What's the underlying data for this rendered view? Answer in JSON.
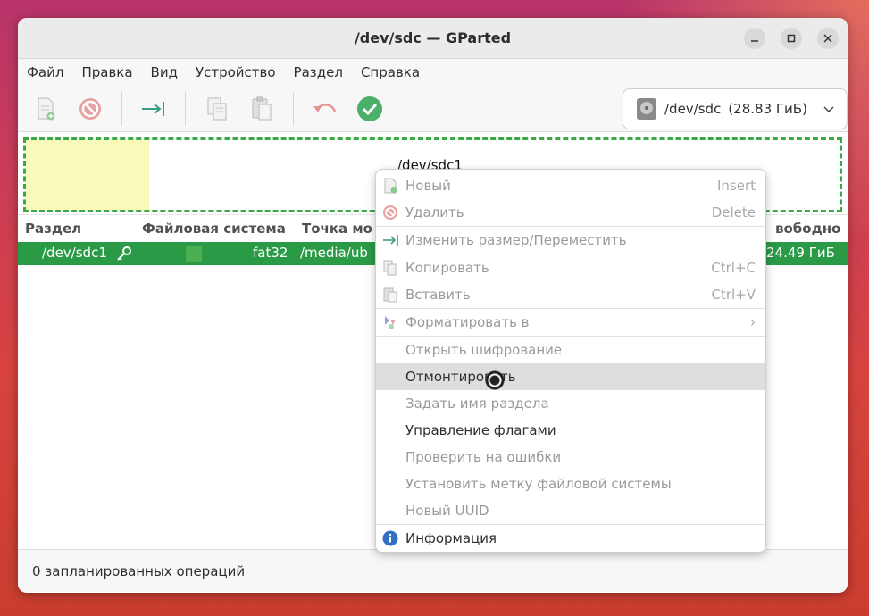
{
  "window": {
    "title": "/dev/sdc — GParted",
    "controls": {
      "minimize": "—",
      "maximize": "□",
      "close": "✕"
    }
  },
  "menubar": [
    "Файл",
    "Правка",
    "Вид",
    "Устройство",
    "Раздел",
    "Справка"
  ],
  "toolbar": {
    "buttons": [
      {
        "icon": "new-partition-icon",
        "enabled": false
      },
      {
        "icon": "delete-icon",
        "enabled": false
      },
      {
        "icon": "resize-move-icon",
        "enabled": true
      },
      {
        "icon": "copy-icon",
        "enabled": false
      },
      {
        "icon": "paste-icon",
        "enabled": false
      },
      {
        "icon": "undo-icon",
        "enabled": false
      },
      {
        "icon": "apply-icon",
        "enabled": true
      }
    ],
    "device": {
      "name": "/dev/sdc",
      "size": "(28.83 ГиБ)"
    }
  },
  "graph": {
    "label": "/dev/sdc1"
  },
  "table": {
    "columns": [
      "Раздел",
      "Файловая система",
      "Точка мо",
      "вободно"
    ],
    "rows": [
      {
        "partition": "/dev/sdc1",
        "fs": "fat32",
        "mount": "/media/ub",
        "free": "24.49 ГиБ",
        "fs_color": "#4caf50"
      }
    ]
  },
  "status": "0 запланированных операций",
  "context_menu": {
    "items": [
      {
        "label": "Новый",
        "accel": "Insert",
        "enabled": false,
        "icon": "new-icon"
      },
      {
        "label": "Удалить",
        "accel": "Delete",
        "enabled": false,
        "icon": "delete-icon"
      },
      {
        "label": "Изменить размер/Переместить",
        "accel": "",
        "enabled": false,
        "icon": "resize-icon"
      },
      {
        "label": "Копировать",
        "accel": "Ctrl+C",
        "enabled": false,
        "icon": "copy-icon"
      },
      {
        "label": "Вставить",
        "accel": "Ctrl+V",
        "enabled": false,
        "icon": "paste-icon"
      },
      {
        "label": "Форматировать в",
        "accel": "›",
        "enabled": false,
        "icon": "format-icon"
      },
      {
        "label": "Открыть шифрование",
        "accel": "",
        "enabled": false,
        "icon": ""
      },
      {
        "label": "Отмонтировать",
        "accel": "",
        "enabled": true,
        "icon": "",
        "highlighted": true
      },
      {
        "label": "Задать имя раздела",
        "accel": "",
        "enabled": false,
        "icon": ""
      },
      {
        "label": "Управление флагами",
        "accel": "",
        "enabled": true,
        "icon": ""
      },
      {
        "label": "Проверить на ошибки",
        "accel": "",
        "enabled": false,
        "icon": ""
      },
      {
        "label": "Установить метку файловой системы",
        "accel": "",
        "enabled": false,
        "icon": ""
      },
      {
        "label": "Новый UUID",
        "accel": "",
        "enabled": false,
        "icon": ""
      },
      {
        "label": "Информация",
        "accel": "",
        "enabled": true,
        "icon": "info-icon"
      }
    ]
  },
  "colors": {
    "selection": "#2a9a46",
    "graph_border": "#3aa845",
    "used_space": "#f9f9b9"
  }
}
